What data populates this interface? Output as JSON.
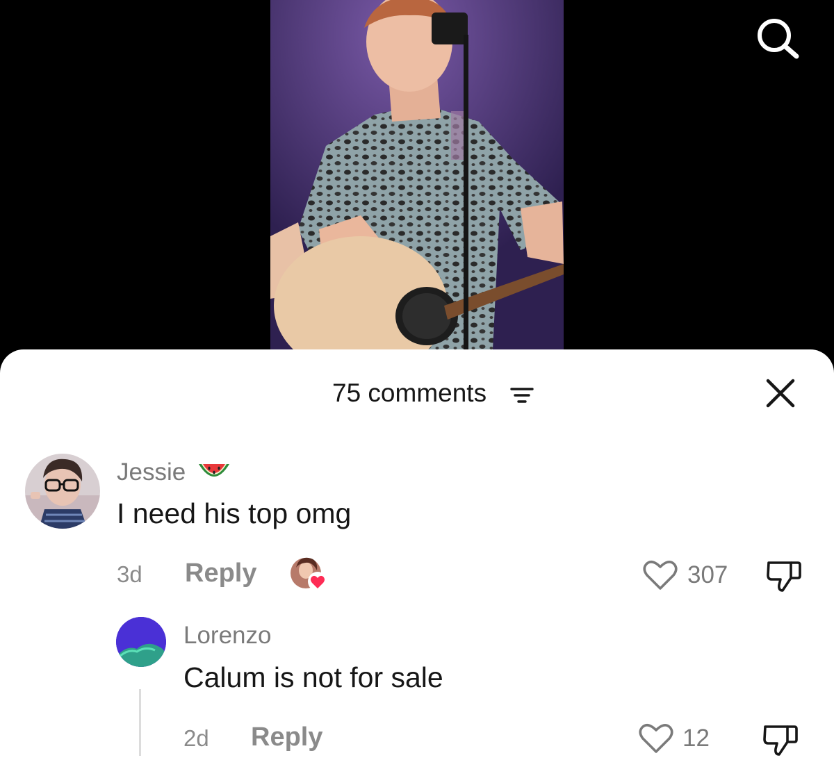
{
  "video": {
    "search_icon": "search-icon"
  },
  "comments_sheet": {
    "count_label": "75 comments",
    "filter_icon": "filter-icon",
    "close_icon": "close-icon"
  },
  "comments": [
    {
      "username": "Jessie",
      "username_emoji": "watermelon-emoji",
      "text": "I need his top omg",
      "timestamp": "3d",
      "reply_label": "Reply",
      "creator_liked": true,
      "likes": "307"
    },
    {
      "username": "Lorenzo",
      "text": "Calum is not for sale",
      "timestamp": "2d",
      "reply_label": "Reply",
      "likes": "12"
    }
  ],
  "colors": {
    "heart_badge": "#fe2c55",
    "muted_text": "#8a8a8a",
    "primary_text": "#161616"
  }
}
